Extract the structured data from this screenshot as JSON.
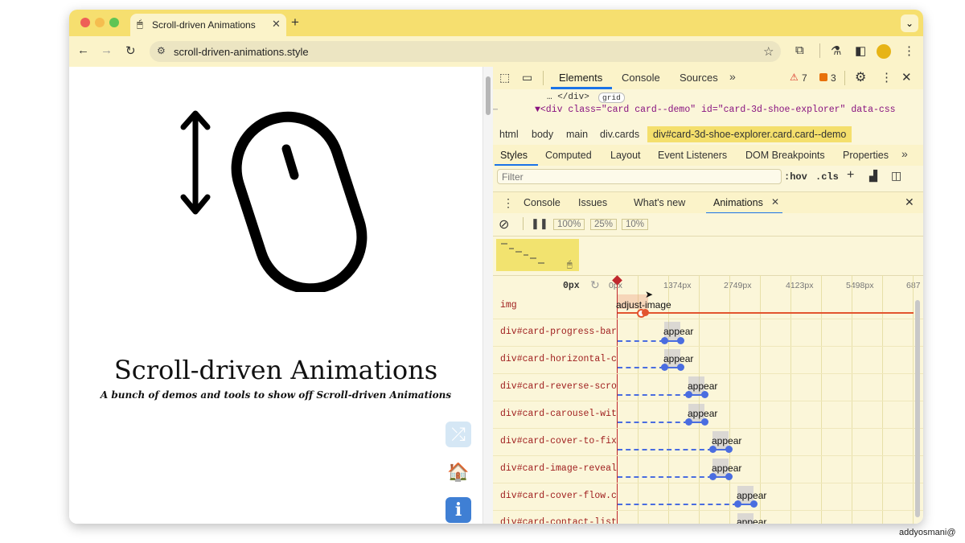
{
  "browser": {
    "tab_title": "Scroll-driven Animations",
    "url": "scroll-driven-animations.style",
    "new_tab_label": "+",
    "colors": {
      "tabstrip": "#f6df6f",
      "toolbar": "#fbf3c9"
    }
  },
  "page": {
    "title": "Scroll-driven Animations",
    "subtitle": "A bunch of demos and tools to show off Scroll-driven Animations",
    "icons": [
      "shuffle-icon",
      "home-icon",
      "info-icon"
    ]
  },
  "devtools": {
    "tabs": [
      "Elements",
      "Console",
      "Sources"
    ],
    "active_tab": "Elements",
    "warnings": "7",
    "errors": "3",
    "dom_lines": [
      "… </div>",
      "grid",
      "▼<div class=\"card card--demo\" id=\"card-3d-shoe-explorer\" data-css"
    ],
    "breadcrumbs": [
      "html",
      "body",
      "main",
      "div.cards",
      "div#card-3d-shoe-explorer.card.card--demo"
    ],
    "style_tabs": [
      "Styles",
      "Computed",
      "Layout",
      "Event Listeners",
      "DOM Breakpoints",
      "Properties"
    ],
    "filter_placeholder": "Filter",
    "hov": ":hov",
    "cls": ".cls",
    "drawer_tabs": [
      "Console",
      "Issues",
      "What's new",
      "Animations"
    ],
    "speeds": [
      "100%",
      "25%",
      "10%"
    ],
    "timeline": {
      "current": "0px",
      "ticks": [
        "0px",
        "1374px",
        "2749px",
        "4123px",
        "5498px",
        "687"
      ]
    },
    "rows": [
      {
        "label": "img",
        "animation": "adjust-image"
      },
      {
        "label": "div#card-progress-bar.",
        "animation": "appear"
      },
      {
        "label": "div#card-horizontal-ca",
        "animation": "appear"
      },
      {
        "label": "div#card-reverse-scrol",
        "animation": "appear"
      },
      {
        "label": "div#card-carousel-with",
        "animation": "appear"
      },
      {
        "label": "div#card-cover-to-fixe",
        "animation": "appear"
      },
      {
        "label": "div#card-image-reveal.",
        "animation": "appear"
      },
      {
        "label": "div#card-cover-flow.ca",
        "animation": "appear"
      },
      {
        "label": "div#card-contact-list.",
        "animation": "appear"
      }
    ]
  },
  "watermark": "addyosmani@"
}
